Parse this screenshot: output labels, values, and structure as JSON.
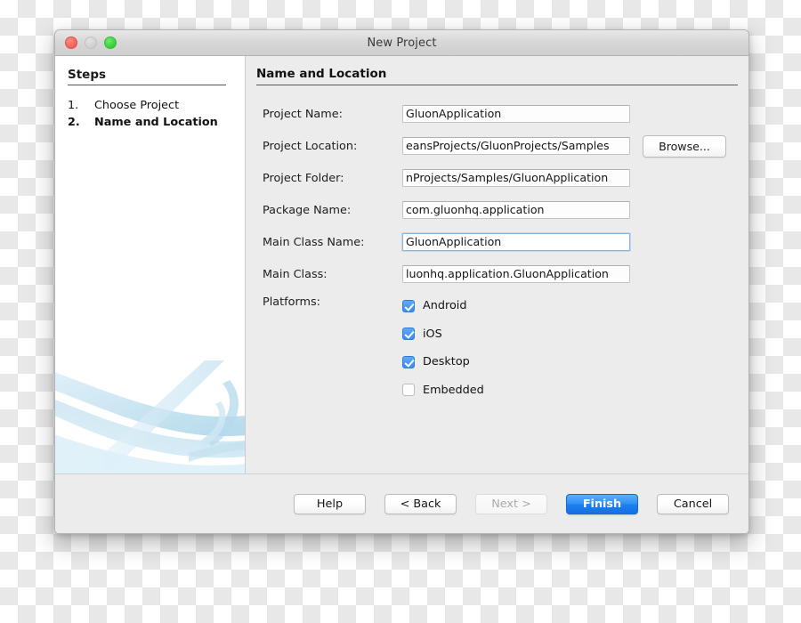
{
  "window": {
    "title": "New Project",
    "controls": [
      "close-button",
      "minimize-button",
      "zoom-button"
    ]
  },
  "sidebar": {
    "title": "Steps",
    "steps": [
      {
        "number": "1.",
        "label": "Choose Project",
        "current": false
      },
      {
        "number": "2.",
        "label": "Name and Location",
        "current": true
      }
    ]
  },
  "panel": {
    "title": "Name and Location",
    "fields": [
      {
        "label": "Project Name:",
        "value": "GluonApplication",
        "focused": false,
        "browse": false
      },
      {
        "label": "Project Location:",
        "value": "eansProjects/GluonProjects/Samples",
        "focused": false,
        "browse": true
      },
      {
        "label": "Project Folder:",
        "value": "nProjects/Samples/GluonApplication",
        "focused": false,
        "browse": false
      },
      {
        "label": "Package Name:",
        "value": "com.gluonhq.application",
        "focused": false,
        "browse": false
      },
      {
        "label": "Main Class Name:",
        "value": "GluonApplication",
        "focused": true,
        "browse": false
      },
      {
        "label": "Main Class:",
        "value": "luonhq.application.GluonApplication",
        "focused": false,
        "browse": false
      }
    ],
    "browse_label": "Browse...",
    "platforms_label": "Platforms:",
    "platforms": [
      {
        "label": "Android",
        "checked": true
      },
      {
        "label": "iOS",
        "checked": true
      },
      {
        "label": "Desktop",
        "checked": true
      },
      {
        "label": "Embedded",
        "checked": false
      }
    ]
  },
  "footer": {
    "buttons": [
      {
        "label": "Help",
        "style": "normal",
        "disabled": false
      },
      {
        "label": "< Back",
        "style": "normal",
        "disabled": false
      },
      {
        "label": "Next >",
        "style": "normal",
        "disabled": true
      },
      {
        "label": "Finish",
        "style": "primary",
        "disabled": false
      },
      {
        "label": "Cancel",
        "style": "normal",
        "disabled": false
      }
    ]
  },
  "colors": {
    "accent": "#2e90f5",
    "checkbox_on": "#3b8ced",
    "focus_border": "#84b4e2",
    "window_bg": "#ececec",
    "sidebar_bg": "#ffffff",
    "art_blue": "#bcddee"
  }
}
